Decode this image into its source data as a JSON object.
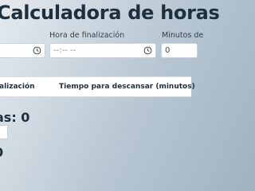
{
  "header": {
    "title": "Calculadora de horas"
  },
  "fields": {
    "end_label": "Hora de finalización",
    "minutes_label": "Minutos de",
    "start_value": "",
    "end_value": "--:-- --",
    "minutes_value": "0"
  },
  "table": {
    "col1": "alización",
    "col2": "Tiempo para descansar (minutos)"
  },
  "summary": {
    "total_text": "as: 0",
    "bottom_text": "0"
  }
}
